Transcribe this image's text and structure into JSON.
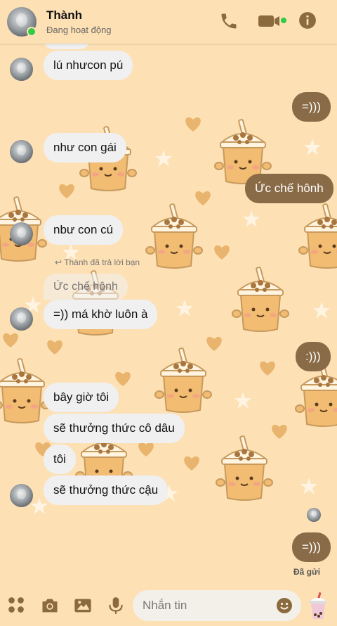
{
  "header": {
    "contact_name": "Thành",
    "status": "Đang hoạt động"
  },
  "messages": {
    "m1": "lú nhưcon pú",
    "m2": "=)))",
    "m3": "như con gái",
    "m4": "Ức chế hônh",
    "m5": "nbư con cú",
    "reply_label": "Thành đã trả lời bạn",
    "reply_quote": "Ức chế hônh",
    "m6": "=)) má khờ luôn à",
    "m7": ":)))",
    "m8": "bây giờ tôi",
    "m9": "sẽ thưởng thức cô dâu",
    "m10": "tôi",
    "m11": "sẽ thưởng thức cậu",
    "m12": "=)))",
    "seen_label": "Đã gửi"
  },
  "composer": {
    "placeholder": "Nhắn tin"
  },
  "icons": {
    "call": "phone-icon",
    "video": "video-icon",
    "info": "info-icon",
    "menu": "grid-icon",
    "camera": "camera-icon",
    "gallery": "image-icon",
    "mic": "microphone-icon",
    "emoji": "emoji-icon",
    "sticker": "bubble-tea-icon"
  },
  "colors": {
    "background": "#fde0b4",
    "outgoing_bubble": "#8a6b47",
    "incoming_bubble": "#f0f0f0",
    "accent": "#8b6a3e",
    "online": "#31cc46"
  }
}
